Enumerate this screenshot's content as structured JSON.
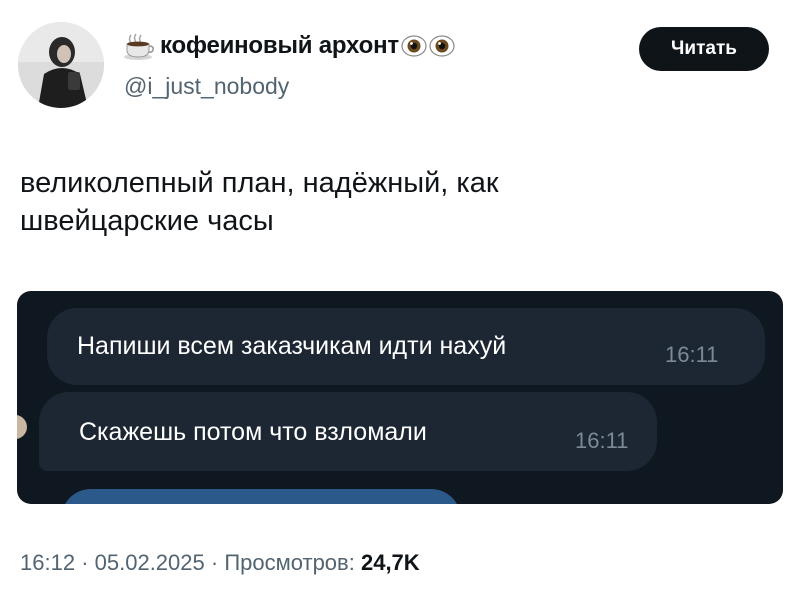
{
  "author": {
    "display_name": "кофеиновый архонт",
    "handle": "@i_just_nobody",
    "avatar_icon": "profile-photo",
    "name_prefix_icon": "hot-beverage-emoji",
    "name_suffix_icons": [
      "eye-emoji",
      "eye-emoji"
    ]
  },
  "follow_button": {
    "label": "Читать"
  },
  "post": {
    "lines": [
      "великолепный план, надёжный, как",
      "швейцарские часы"
    ]
  },
  "embedded_chat": {
    "background": "#0f1721",
    "bubble_color": "#1c2733",
    "messages": [
      {
        "text": "Напиши всем заказчикам идти нахуй",
        "time": "16:11"
      },
      {
        "text": "Скажешь потом что взломали",
        "time": "16:11"
      }
    ]
  },
  "meta": {
    "time": "16:12",
    "separator": "·",
    "date": "05.02.2025",
    "views_label": "Просмотров:",
    "views_value": "24,7K"
  }
}
